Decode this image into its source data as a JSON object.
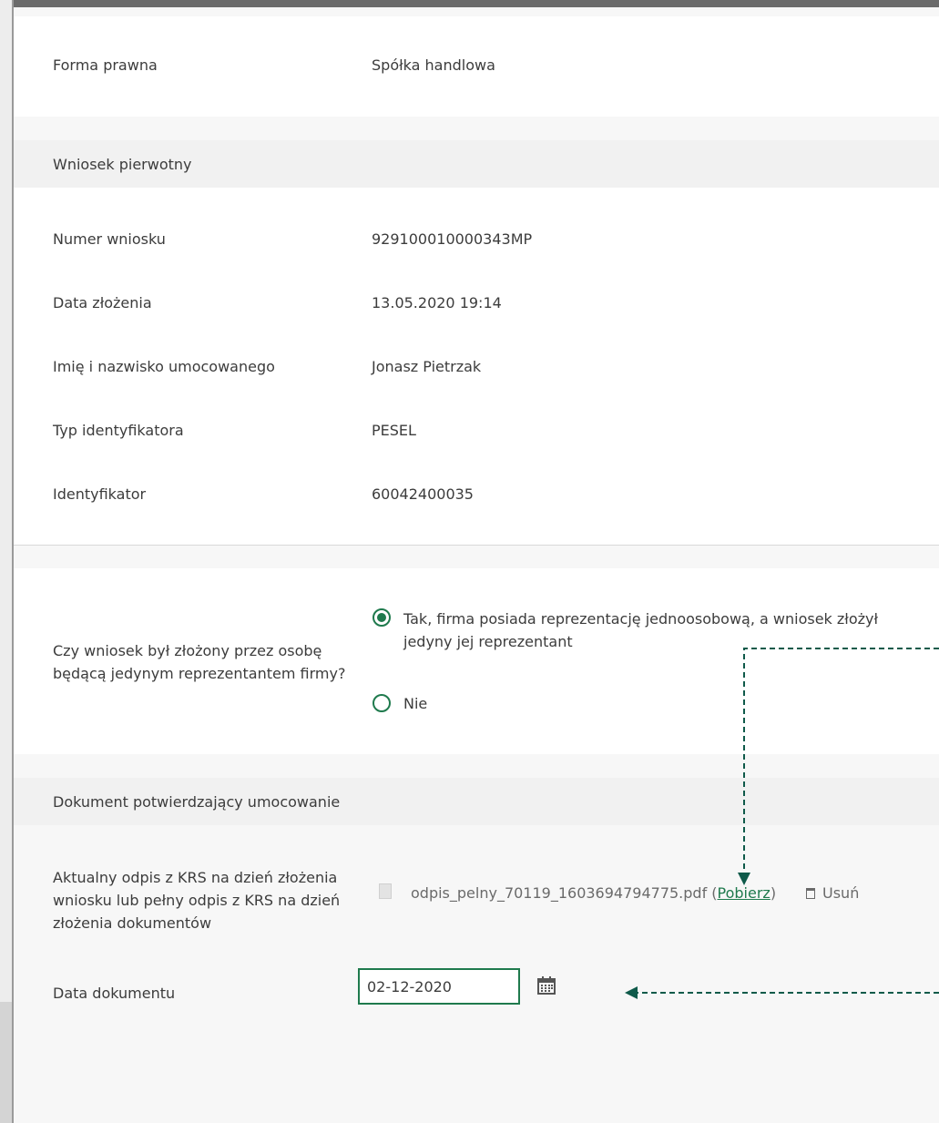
{
  "company": {
    "legal_form_label": "Forma prawna",
    "legal_form_value": "Spółka handlowa"
  },
  "original_application": {
    "section_title": "Wniosek pierwotny",
    "fields": [
      {
        "label": "Numer wniosku",
        "value": "929100010000343MP"
      },
      {
        "label": "Data złożenia",
        "value": "13.05.2020 19:14"
      },
      {
        "label": "Imię i nazwisko umocowanego",
        "value": "Jonasz Pietrzak"
      },
      {
        "label": "Typ identyfikatora",
        "value": "PESEL"
      },
      {
        "label": "Identyfikator",
        "value": "60042400035"
      }
    ]
  },
  "representative_question": {
    "line1": "Czy wniosek był złożony przez osobę",
    "line2": "będącą jedynym reprezentantem firmy?",
    "options": [
      {
        "line1": "Tak, firma posiada reprezentację jednoosobową, a wniosek złożył",
        "line2": "jedyny jej reprezentant",
        "selected": true
      },
      {
        "line1": "Nie",
        "selected": false
      }
    ]
  },
  "authorization_document": {
    "section_title": "Dokument potwierdzający umocowanie",
    "krs_label_lines": [
      "Aktualny odpis z KRS na dzień złożenia",
      "wniosku lub pełny odpis z KRS na dzień",
      "złożenia dokumentów"
    ],
    "file_name": "odpis_pelny_70119_1603694794775.pdf",
    "paren_open": " (",
    "download_label": "Pobierz",
    "paren_close": ")",
    "delete_label": "Usuń",
    "date_label": "Data dokumentu",
    "date_value": "02-12-2020"
  },
  "colors": {
    "accent": "#1f7a4d",
    "arrow": "#0f5a4a"
  }
}
